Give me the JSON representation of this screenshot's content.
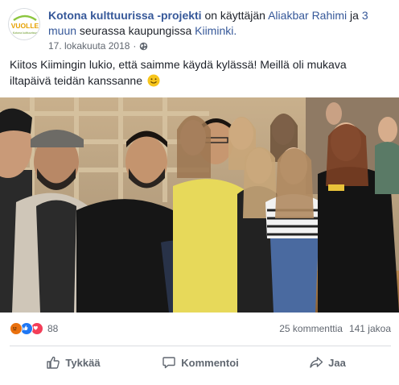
{
  "post": {
    "page_name": "Kotona kulttuurissa -projekti",
    "header_mid": " on käyttäjän ",
    "author": "Aliakbar Rahimi",
    "header_and": " ja ",
    "others": "3 muun",
    "header_loc": " seurassa kaupungissa ",
    "location": "Kiiminki.",
    "date": "17. lokakuuta 2018",
    "date_sep": "·",
    "privacy_icon": "globe-icon",
    "text": "Kiitos Kiimingin lukio, että saimme käydä kylässä! Meillä oli mukava iltapäivä teidän kanssanne",
    "emoji": "smiley-icon",
    "logo_text": "VUOLLE",
    "logo_subtext": "Kotona kulttuurissa"
  },
  "reactions": {
    "icons": [
      "angry-reaction-icon",
      "like-reaction-icon",
      "love-reaction-icon"
    ],
    "count": "88",
    "comments": "25 kommenttia",
    "shares": "141 jakoa"
  },
  "actions": {
    "like": "Tykkää",
    "comment": "Kommentoi",
    "share": "Jaa"
  },
  "colors": {
    "link": "#365899",
    "secondary_text": "#616770",
    "like_blue": "#2078f4",
    "love_red": "#f33e58",
    "angry_orange": "#e9710f"
  }
}
